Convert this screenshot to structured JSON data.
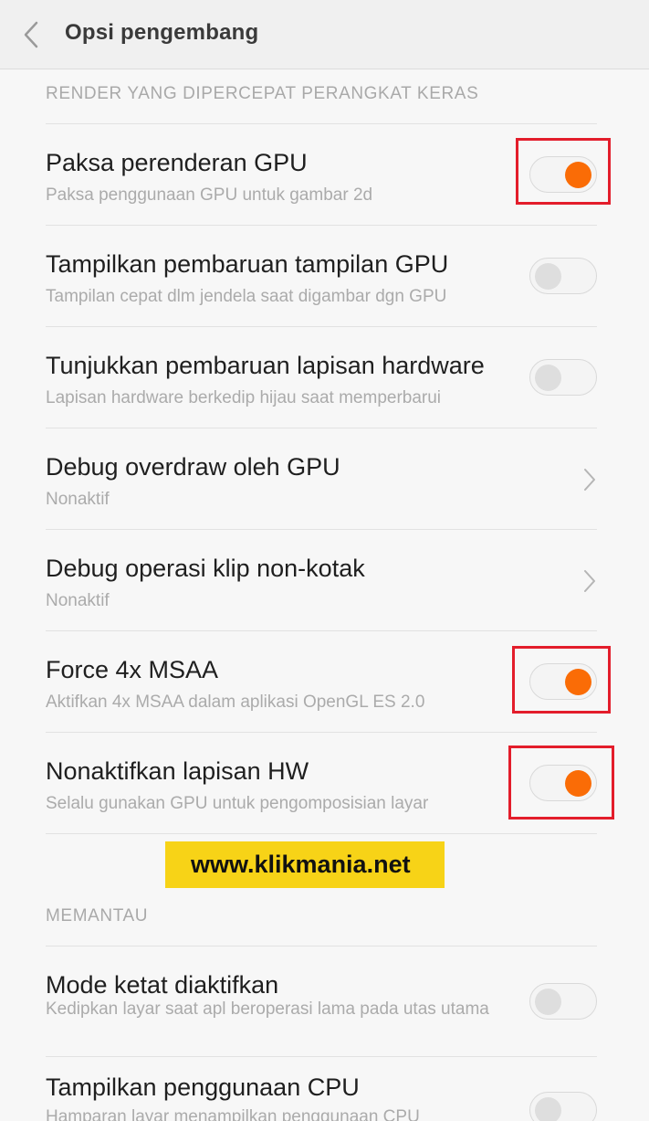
{
  "header": {
    "title": "Opsi pengembang",
    "back_icon": "chevron-left-icon"
  },
  "sections": [
    {
      "header": "RENDER YANG DIPERCEPAT PERANGKAT KERAS",
      "items": [
        {
          "title": "Paksa perenderan GPU",
          "subtitle": "Paksa penggunaan GPU untuk gambar 2d",
          "control": "toggle",
          "state": "on"
        },
        {
          "title": "Tampilkan pembaruan tampilan GPU",
          "subtitle": "Tampilan cepat dlm jendela saat digambar dgn GPU",
          "control": "toggle",
          "state": "off"
        },
        {
          "title": "Tunjukkan pembaruan lapisan hardware",
          "subtitle": "Lapisan hardware berkedip hijau saat memperbarui",
          "control": "toggle",
          "state": "off"
        },
        {
          "title": "Debug overdraw oleh GPU",
          "subtitle": "Nonaktif",
          "control": "chevron"
        },
        {
          "title": "Debug operasi klip non-kotak",
          "subtitle": "Nonaktif",
          "control": "chevron"
        },
        {
          "title": "Force 4x MSAA",
          "subtitle": "Aktifkan 4x MSAA dalam aplikasi OpenGL ES 2.0",
          "control": "toggle",
          "state": "on"
        },
        {
          "title": "Nonaktifkan lapisan HW",
          "subtitle": "Selalu gunakan GPU untuk pengomposisian layar",
          "control": "toggle",
          "state": "on"
        }
      ]
    },
    {
      "header": "MEMANTAU",
      "items": [
        {
          "title": "Mode ketat diaktifkan",
          "subtitle": "Kedipkan layar saat apl beroperasi lama pada utas utama",
          "control": "toggle",
          "state": "off"
        },
        {
          "title": "Tampilkan penggunaan CPU",
          "subtitle": "Hamparan layar menampilkan penggunaan CPU",
          "control": "toggle",
          "state": "off"
        }
      ]
    }
  ],
  "watermark": "www.klikmania.net",
  "colors": {
    "toggle_on": "#fa6c06",
    "toggle_off_knob": "#dedede",
    "highlight_box": "#e31d2b",
    "watermark_bg": "#f7d317"
  }
}
